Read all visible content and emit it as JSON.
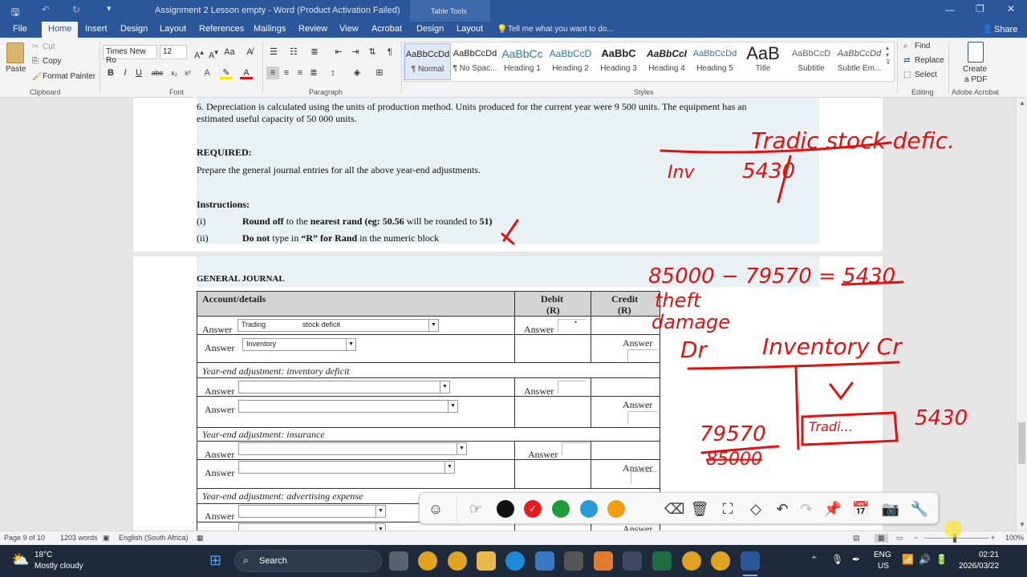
{
  "window": {
    "title": "Assignment 2 Lesson empty - Word (Product Activation Failed)",
    "table_tools": "Table Tools",
    "search_placeholder": "Tell me what you want to do...",
    "share": "Share"
  },
  "tabs": [
    "File",
    "Home",
    "Insert",
    "Design",
    "Layout",
    "References",
    "Mailings",
    "Review",
    "View",
    "Acrobat",
    "Design",
    "Layout"
  ],
  "ribbon": {
    "clipboard": {
      "paste": "Paste",
      "cut": "Cut",
      "copy": "Copy",
      "format_painter": "Format Painter",
      "label": "Clipboard"
    },
    "font": {
      "name": "Times New Ro",
      "size": "12",
      "label": "Font"
    },
    "paragraph": {
      "label": "Paragraph"
    },
    "styles": {
      "label": "Styles",
      "items": [
        {
          "preview": "AaBbCcDd",
          "name": "¶ Normal"
        },
        {
          "preview": "AaBbCcDd",
          "name": "¶ No Spac..."
        },
        {
          "preview": "AaBbCc",
          "name": "Heading 1"
        },
        {
          "preview": "AaBbCcD",
          "name": "Heading 2"
        },
        {
          "preview": "AaBbC",
          "name": "Heading 3"
        },
        {
          "preview": "AaBbCcI",
          "name": "Heading 4"
        },
        {
          "preview": "AaBbCcDd",
          "name": "Heading 5"
        },
        {
          "preview": "AaB",
          "name": "Title"
        },
        {
          "preview": "AaBbCcD",
          "name": "Subtitle"
        },
        {
          "preview": "AaBbCcDd",
          "name": "Subtle Em..."
        }
      ]
    },
    "editing": {
      "find": "Find",
      "replace": "Replace",
      "select": "Select",
      "label": "Editing"
    },
    "acrobat": {
      "create_line1": "Create",
      "create_line2": "a PDF",
      "label": "Adobe Acrobat"
    }
  },
  "document": {
    "item6_line1": "6.     Depreciation is calculated using the units of production method. Units produced for the current year were 9 500 units. The equipment has an",
    "item6_line2": "estimated useful capacity of 50 000 units.",
    "required_heading": "REQUIRED:",
    "required_text": "Prepare the general journal entries for all the above year-end adjustments.",
    "instructions_heading": "Instructions:",
    "instr_i_num": "(i)",
    "instr_i_a": "Round off",
    "instr_i_b": " to the ",
    "instr_i_c": "nearest rand",
    "instr_i_d": " (eg: 50.56",
    "instr_i_e": " will be rounded to ",
    "instr_i_f": "51)",
    "instr_ii_num": "(ii)",
    "instr_ii_a": "Do not",
    "instr_ii_b": " type in ",
    "instr_ii_c": "“R” for Rand",
    "instr_ii_d": " in the numeric block",
    "gj_heading": "GENERAL JOURNAL",
    "col_account": "Account/details",
    "col_debit": "Debit",
    "col_credit": "Credit",
    "col_unit": "(R)",
    "answer": "Answer",
    "dd_trading": "Trading",
    "dd_trading2": "stock deficit",
    "dd_inventory": "Inventory",
    "adj_inventory": "Year-end adjustment:   inventory deficit",
    "adj_insurance": "Year-end adjustment: insurance",
    "adj_advertising": "Year-end adjustment: advertising expense"
  },
  "annotations": {
    "trading_stock": "Tradic stock defic.",
    "inv": "Inv",
    "inv_amount": "5430",
    "calc": "85000 − 79570 = 5430",
    "theft": "theft",
    "damage": "damage",
    "dr": "Dr",
    "inventory_cr": "Inventory   Cr",
    "amt_79570": "79570",
    "amt_85000": "85000",
    "amt_5430": "5430",
    "trading_abbr": "Tradi..."
  },
  "statusbar": {
    "page": "Page 9 of 10",
    "words": "1203 words",
    "language": "English (South Africa)",
    "zoom": "100%"
  },
  "taskbar": {
    "weather_temp": "18°C",
    "weather_desc": "Mostly cloudy",
    "search": "Search",
    "lang1": "ENG",
    "lang2": "US",
    "time": "02:21",
    "date": "2026/03/22"
  },
  "colors": {
    "accent": "#2b579a",
    "ink": "#e31010",
    "pen_black": "#111111",
    "pen_red": "#e51c1c",
    "pen_green": "#1f9c3a",
    "pen_blue": "#2a9ad8",
    "pen_orange": "#f39b12"
  }
}
